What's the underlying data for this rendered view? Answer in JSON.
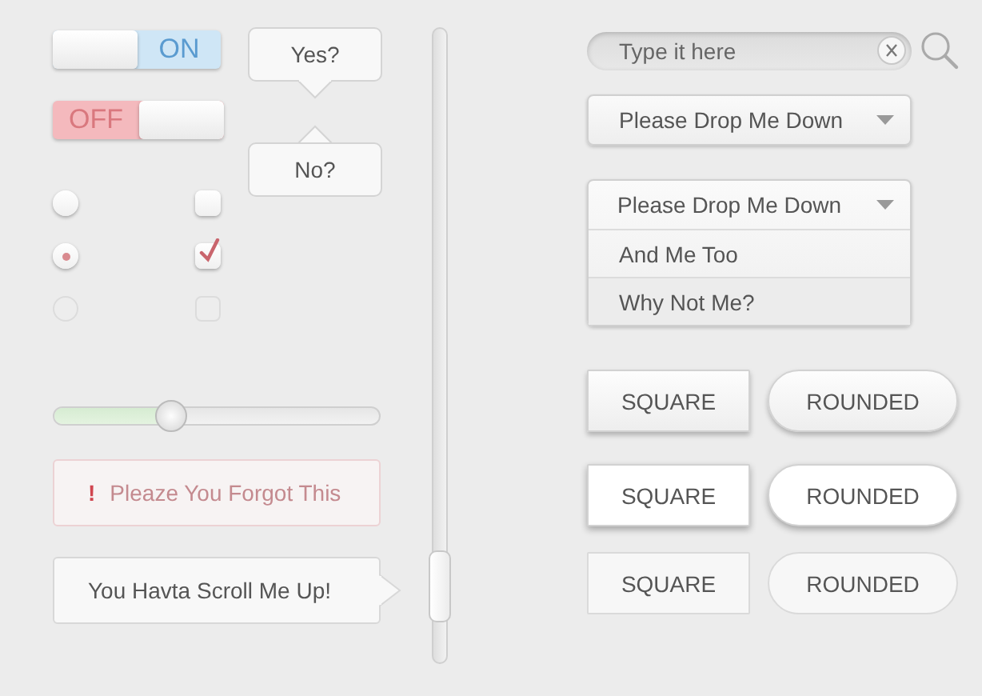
{
  "toggles": [
    {
      "label": "ON",
      "on": true
    },
    {
      "label": "OFF",
      "on": false
    }
  ],
  "bubbles": [
    {
      "text": "Yes?",
      "kind": "below"
    },
    {
      "text": "No?",
      "kind": "above"
    }
  ],
  "radios": [
    {
      "checked": false,
      "disabled": false
    },
    {
      "checked": true,
      "disabled": false
    },
    {
      "checked": false,
      "disabled": true
    }
  ],
  "checkboxes": [
    {
      "checked": false,
      "disabled": false
    },
    {
      "checked": true,
      "disabled": false
    },
    {
      "checked": false,
      "disabled": true
    }
  ],
  "slider": {
    "level": 0.36
  },
  "error": {
    "mark": "!",
    "text": "Pleaze You Forgot This"
  },
  "tooltip": {
    "text": "You Havta Scroll Me Up!"
  },
  "search": {
    "placeholder": "Type it here"
  },
  "dropdowns": [
    {
      "label": "Please Drop Me Down",
      "expanded": false
    },
    {
      "label": "Please Drop Me Down",
      "expanded": true,
      "options": [
        "And Me Too",
        "Why Not Me?"
      ]
    }
  ],
  "button_rows": [
    {
      "kind": "raised",
      "buttons": [
        {
          "kind": "square",
          "label": "SQUARE"
        },
        {
          "kind": "rounded",
          "label": "ROUNDED"
        }
      ]
    },
    {
      "kind": "bright",
      "buttons": [
        {
          "kind": "square",
          "label": "SQUARE"
        },
        {
          "kind": "rounded",
          "label": "ROUNDED"
        }
      ]
    },
    {
      "kind": "flat",
      "buttons": [
        {
          "kind": "square",
          "label": "SQUARE"
        },
        {
          "kind": "rounded",
          "label": "ROUNDED"
        }
      ]
    }
  ]
}
